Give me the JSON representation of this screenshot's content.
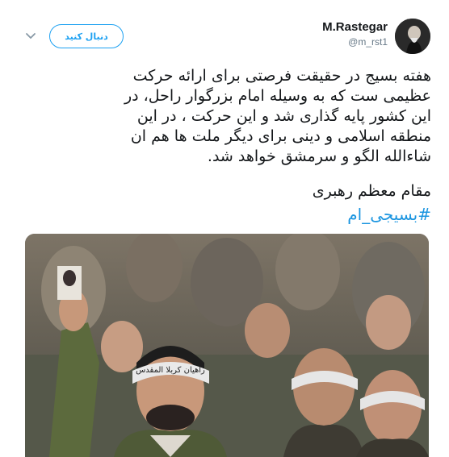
{
  "tweet": {
    "display_name": "M.Rastegar",
    "handle": "@m_rst1",
    "follow_label": "دنبال کنید",
    "text": "هفته بسیج در حقیقت فرصتی برای ارائه حرکت\nعظیمی ست که به وسیله امام بزرگوار راحل، در\nاین کشور پایه گذاری شد و این حرکت ، در این\nمنطقه اسلامی و دینی برای دیگر ملت ها هم ان\nشاءالله الگو و سرمشق خواهد شد.",
    "signature": "مقام معظم رهبری",
    "hashtag": "#بسیجی_ام"
  },
  "photo": {
    "headband_text": "راهیان کربلا المقدس"
  },
  "colors": {
    "accent": "#1da1f2",
    "hashtag": "#1b95e0",
    "secondary_text": "#657786"
  },
  "icons": {
    "menu": "chevron-down-icon"
  }
}
